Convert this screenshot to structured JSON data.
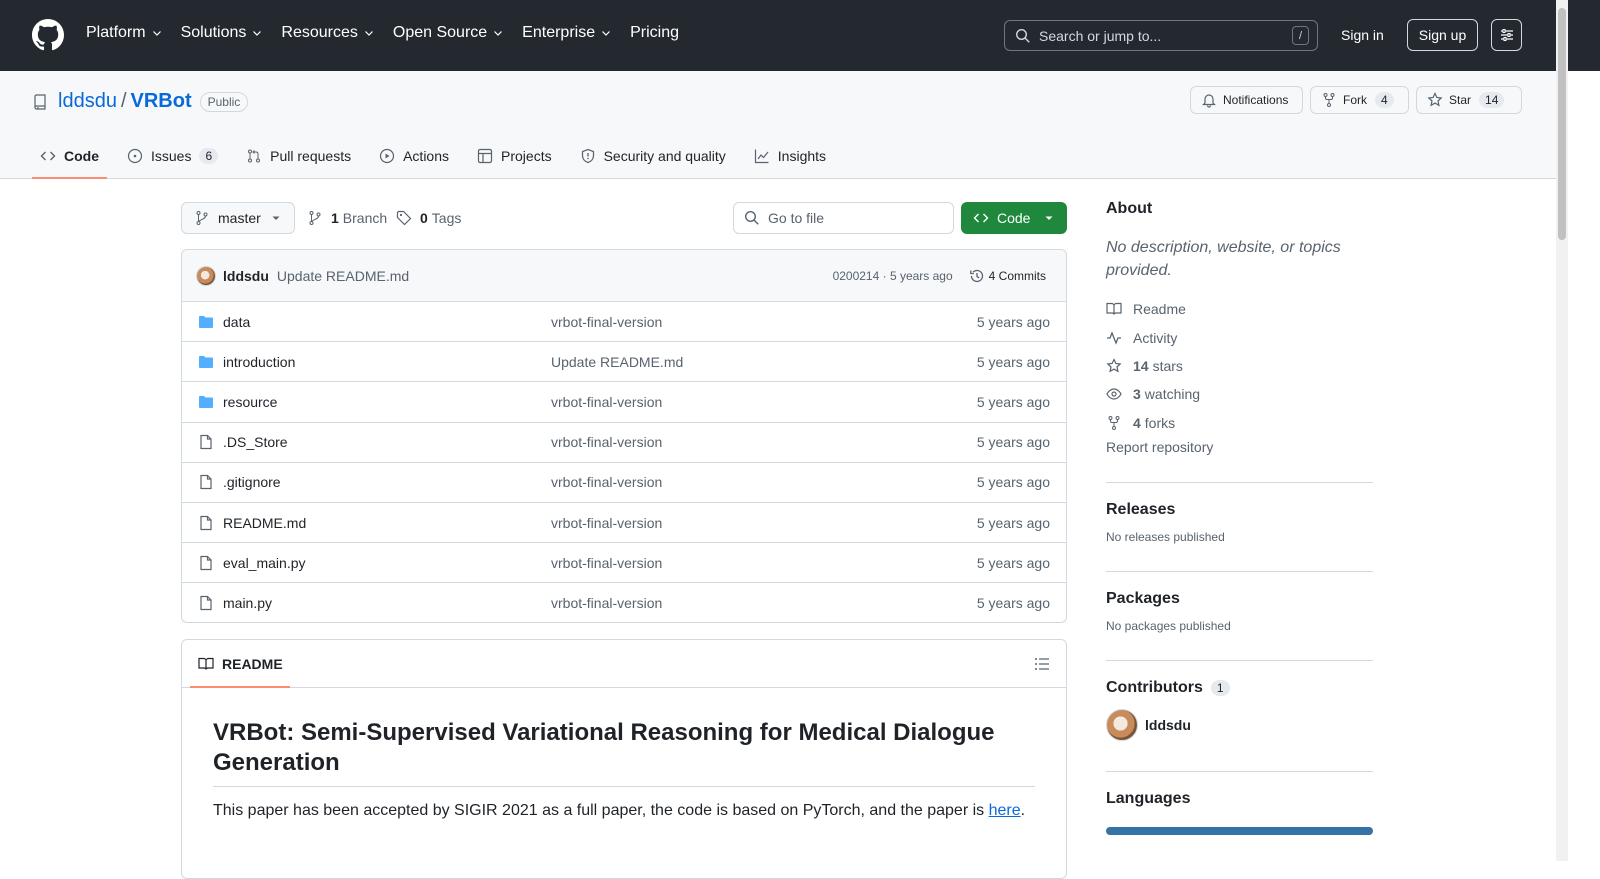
{
  "header": {
    "nav": [
      "Platform",
      "Solutions",
      "Resources",
      "Open Source",
      "Enterprise",
      "Pricing"
    ],
    "search_placeholder": "Search or jump to...",
    "search_shortcut": "/",
    "sign_in": "Sign in",
    "sign_up": "Sign up"
  },
  "repo": {
    "owner": "lddsdu",
    "separator": "/",
    "name": "VRBot",
    "visibility": "Public",
    "notifications_label": "Notifications",
    "fork_label": "Fork",
    "fork_count": "4",
    "star_label": "Star",
    "star_count": "14"
  },
  "tabs": [
    {
      "label": "Code",
      "selected": true
    },
    {
      "label": "Issues",
      "count": "6"
    },
    {
      "label": "Pull requests"
    },
    {
      "label": "Actions"
    },
    {
      "label": "Projects"
    },
    {
      "label": "Security and quality"
    },
    {
      "label": "Insights"
    }
  ],
  "toolbar": {
    "branch": "master",
    "branch_count": "1",
    "branch_label": "Branch",
    "tag_count": "0",
    "tag_label": "Tags",
    "go_to_file": "Go to file",
    "code_label": "Code"
  },
  "commit": {
    "author": "lddsdu",
    "message": "Update README.md",
    "sha_time": "0200214 · 5 years ago",
    "commits": "4 Commits"
  },
  "files": [
    {
      "name": "data",
      "type": "dir",
      "message": "vrbot-final-version",
      "time": "5 years ago"
    },
    {
      "name": "introduction",
      "type": "dir",
      "message": "Update README.md",
      "time": "5 years ago"
    },
    {
      "name": "resource",
      "type": "dir",
      "message": "vrbot-final-version",
      "time": "5 years ago"
    },
    {
      "name": ".DS_Store",
      "type": "file",
      "message": "vrbot-final-version",
      "time": "5 years ago"
    },
    {
      "name": ".gitignore",
      "type": "file",
      "message": "vrbot-final-version",
      "time": "5 years ago"
    },
    {
      "name": "README.md",
      "type": "file",
      "message": "vrbot-final-version",
      "time": "5 years ago"
    },
    {
      "name": "eval_main.py",
      "type": "file",
      "message": "vrbot-final-version",
      "time": "5 years ago"
    },
    {
      "name": "main.py",
      "type": "file",
      "message": "vrbot-final-version",
      "time": "5 years ago"
    }
  ],
  "readme": {
    "tab_label": "README",
    "title": "VRBot: Semi-Supervised Variational Reasoning for Medical Dialogue Generation",
    "text": "This paper has been accepted by SIGIR 2021 as a full paper, the code is based on PyTorch, and the paper is ",
    "link": "here",
    "text_end": "."
  },
  "sidebar": {
    "about_title": "About",
    "about_desc": "No description, website, or topics provided.",
    "readme": "Readme",
    "activity": "Activity",
    "stars_count": "14",
    "stars_label": "stars",
    "watching_count": "3",
    "watching_label": "watching",
    "forks_count": "4",
    "forks_label": "forks",
    "report": "Report repository",
    "releases_title": "Releases",
    "releases_text": "No releases published",
    "packages_title": "Packages",
    "packages_text": "No packages published",
    "contributors_title": "Contributors",
    "contributors_count": "1",
    "contributor": "lddsdu",
    "languages_title": "Languages"
  },
  "colors": {
    "header_bg": "#24292f",
    "link": "#0969da",
    "code_button": "#1f883d",
    "tab_underline": "#fd8c73",
    "folder": "#54aeff",
    "language_bar": "#3572a5"
  }
}
